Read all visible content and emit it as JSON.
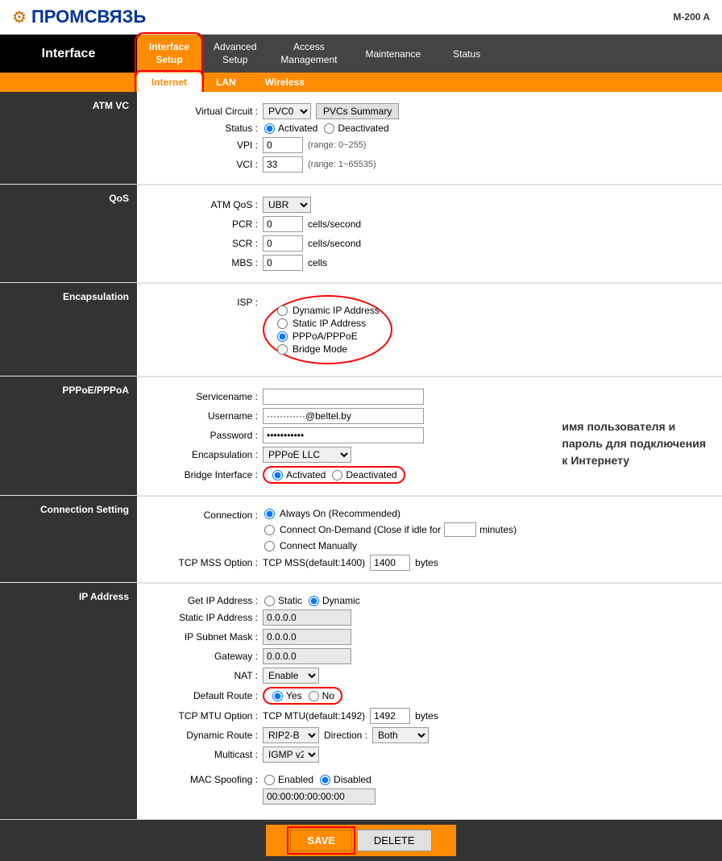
{
  "header": {
    "logo_text": "ПРОМСВЯЗЬ",
    "model": "M-200 A"
  },
  "nav": {
    "interface_label": "Interface",
    "tabs": [
      {
        "id": "interface-setup",
        "label": "Interface\nSetup",
        "active": true
      },
      {
        "id": "advanced-setup",
        "label": "Advanced\nSetup",
        "active": false
      },
      {
        "id": "access-management",
        "label": "Access\nManagement",
        "active": false
      },
      {
        "id": "maintenance",
        "label": "Maintenance",
        "active": false
      },
      {
        "id": "status",
        "label": "Status",
        "active": false
      }
    ],
    "sub_tabs": [
      {
        "id": "internet",
        "label": "Internet",
        "active": true
      },
      {
        "id": "lan",
        "label": "LAN",
        "active": false
      },
      {
        "id": "wireless",
        "label": "Wireless",
        "active": false
      }
    ]
  },
  "atm_vc": {
    "section_label": "ATM VC",
    "virtual_circuit_label": "Virtual Circuit :",
    "virtual_circuit_value": "PVC0",
    "pvcs_summary_btn": "PVCs Summary",
    "status_label": "Status :",
    "status_activated": "Activated",
    "status_deactivated": "Deactivated",
    "vpi_label": "VPI :",
    "vpi_value": "0",
    "vpi_range": "(range: 0~255)",
    "vci_label": "VCI :",
    "vci_value": "33",
    "vci_range": "(range: 1~65535)"
  },
  "qos": {
    "section_label": "QoS",
    "atm_qos_label": "ATM QoS :",
    "atm_qos_value": "UBR",
    "pcr_label": "PCR :",
    "pcr_value": "0",
    "pcr_unit": "cells/second",
    "scr_label": "SCR :",
    "scr_value": "0",
    "scr_unit": "cells/second",
    "mbs_label": "MBS :",
    "mbs_value": "0",
    "mbs_unit": "cells"
  },
  "encapsulation": {
    "section_label": "Encapsulation",
    "isp_label": "ISP :",
    "options": [
      {
        "id": "dynamic-ip",
        "label": "Dynamic IP Address",
        "checked": false
      },
      {
        "id": "static-ip",
        "label": "Static IP Address",
        "checked": false
      },
      {
        "id": "pppoa-pppoe",
        "label": "PPPoA/PPPoE",
        "checked": true
      },
      {
        "id": "bridge-mode",
        "label": "Bridge Mode",
        "checked": false
      }
    ]
  },
  "pppoe_pppoa": {
    "section_label": "PPPoE/PPPoA",
    "servicename_label": "Servicename :",
    "servicename_value": "",
    "username_label": "Username :",
    "username_value": "••••••••••••@beltel.by",
    "password_label": "Password :",
    "password_value": "•••••••••",
    "encapsulation_label": "Encapsulation :",
    "encapsulation_value": "PPPoE LLC",
    "bridge_interface_label": "Bridge Interface :",
    "bridge_activated": "Activated",
    "bridge_deactivated": "Deactivated",
    "annotation": "имя пользователя и\nпароль для подключения\nк Интернету"
  },
  "connection_setting": {
    "section_label": "Connection Setting",
    "connection_label": "Connection :",
    "always_on": "Always On (Recommended)",
    "connect_on_demand": "Connect On-Demand (Close if idle for",
    "connect_on_demand_unit": "minutes)",
    "connect_manually": "Connect Manually",
    "tcp_mss_label": "TCP MSS Option :",
    "tcp_mss_text": "TCP MSS(default:1400)",
    "tcp_mss_value": "1400",
    "tcp_mss_unit": "bytes"
  },
  "ip_address": {
    "section_label": "IP Address",
    "get_ip_label": "Get IP Address :",
    "static": "Static",
    "dynamic": "Dynamic",
    "static_ip_label": "Static IP Address :",
    "static_ip_value": "0.0.0.0",
    "subnet_mask_label": "IP Subnet Mask :",
    "subnet_mask_value": "0.0.0.0",
    "gateway_label": "Gateway :",
    "gateway_value": "0.0.0.0",
    "nat_label": "NAT :",
    "nat_value": "Enable",
    "default_route_label": "Default Route :",
    "yes": "Yes",
    "no": "No",
    "tcp_mtu_label": "TCP MTU Option :",
    "tcp_mtu_text": "TCP MTU(default:1492)",
    "tcp_mtu_value": "1492",
    "tcp_mtu_unit": "bytes",
    "dynamic_route_label": "Dynamic Route :",
    "dynamic_route_value": "RIP2-B",
    "direction_label": "Direction :",
    "direction_value": "Both",
    "multicast_label": "Multicast :",
    "multicast_value": "IGMP v2",
    "mac_spoofing_label": "MAC Spoofing :",
    "mac_enabled": "Enabled",
    "mac_disabled": "Disabled",
    "mac_address": "00:00:00:00:00:00"
  },
  "footer": {
    "save_label": "SAVE",
    "delete_label": "DELETE"
  }
}
